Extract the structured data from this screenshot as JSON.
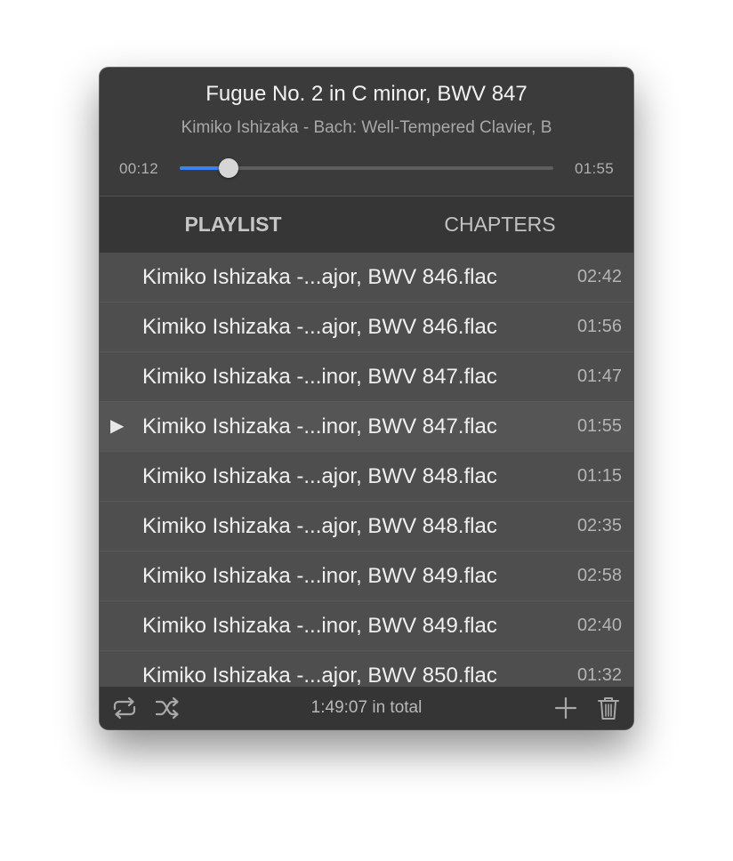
{
  "now_playing": {
    "title": "Fugue No. 2 in C minor, BWV 847",
    "subtitle": "Kimiko Ishizaka - Bach: Well-Tempered Clavier, B",
    "elapsed": "00:12",
    "duration": "01:55",
    "progress": 0.13
  },
  "tabs": {
    "playlist": "PLAYLIST",
    "chapters": "CHAPTERS",
    "active": "playlist"
  },
  "playlist": [
    {
      "name": "Kimiko Ishizaka -...ajor, BWV 846.flac",
      "duration": "02:42",
      "playing": false
    },
    {
      "name": "Kimiko Ishizaka -...ajor, BWV 846.flac",
      "duration": "01:56",
      "playing": false
    },
    {
      "name": "Kimiko Ishizaka -...inor, BWV 847.flac",
      "duration": "01:47",
      "playing": false
    },
    {
      "name": "Kimiko Ishizaka -...inor, BWV 847.flac",
      "duration": "01:55",
      "playing": true
    },
    {
      "name": "Kimiko Ishizaka -...ajor, BWV 848.flac",
      "duration": "01:15",
      "playing": false
    },
    {
      "name": "Kimiko Ishizaka -...ajor, BWV 848.flac",
      "duration": "02:35",
      "playing": false
    },
    {
      "name": "Kimiko Ishizaka -...inor, BWV 849.flac",
      "duration": "02:58",
      "playing": false
    },
    {
      "name": "Kimiko Ishizaka -...inor, BWV 849.flac",
      "duration": "02:40",
      "playing": false
    },
    {
      "name": "Kimiko Ishizaka -...ajor, BWV 850.flac",
      "duration": "01:32",
      "playing": false
    }
  ],
  "playing_indicator": "▶",
  "footer": {
    "total_text": "1:49:07 in total",
    "icons": [
      "repeat-icon",
      "shuffle-icon",
      "add-icon",
      "trash-icon"
    ]
  },
  "colors": {
    "accent": "#3b82f6",
    "window_bg": "#3a3a3a",
    "row_bg": "#4e4e4e"
  }
}
